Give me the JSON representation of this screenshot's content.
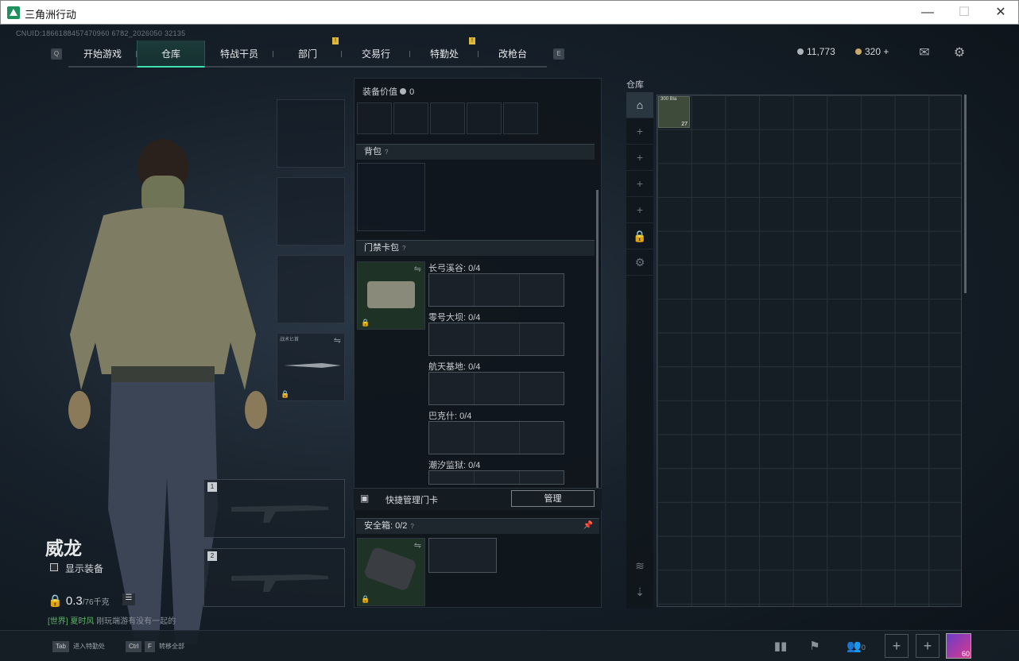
{
  "window": {
    "title": "三角洲行动",
    "min": "—",
    "max": "☐",
    "close": "✕"
  },
  "uid": "CNUID:1866188457470960 6782_2026050 32135",
  "nav": {
    "left_key": "Q",
    "right_key": "E",
    "tabs": [
      {
        "label": "开始游戏",
        "badge": ""
      },
      {
        "label": "仓库",
        "badge": "",
        "active": true
      },
      {
        "label": "特战干员",
        "badge": ""
      },
      {
        "label": "部门",
        "badge": "!"
      },
      {
        "label": "交易行",
        "badge": ""
      },
      {
        "label": "特勤处",
        "badge": "!"
      },
      {
        "label": "改枪台",
        "badge": ""
      }
    ]
  },
  "currency": {
    "silver": "11,773",
    "gold": "320",
    "gold_plus": "+"
  },
  "character": {
    "name": "威龙",
    "show_equip": "显示装备",
    "weight": "0.3",
    "weight_max": "/76千克",
    "knife_label": "战术匕首",
    "weapon1": "1",
    "weapon2": "2"
  },
  "chat": {
    "channel": "[世界]",
    "sender": "夏时风",
    "message": "刚玩端游有没有一起的"
  },
  "equipment": {
    "value_label": "装备价值",
    "value": "0",
    "backpack": "背包",
    "keycard": "门禁卡包",
    "help": "?",
    "maps": [
      {
        "label": "长弓溪谷: 0/4"
      },
      {
        "label": "零号大坝: 0/4"
      },
      {
        "label": "航天基地: 0/4"
      },
      {
        "label": "巴克什: 0/4"
      },
      {
        "label": "潮汐监狱: 0/4"
      }
    ],
    "quick_manage": "快捷管理门卡",
    "manage_btn": "管理",
    "safebox": "安全箱",
    "safebox_count": "0/2"
  },
  "stash": {
    "title": "仓库",
    "item_label": "300 Bla",
    "item_count": "27"
  },
  "bottom": {
    "tab_key": "Tab",
    "tab_hint": "进入特勤处",
    "ctrl_key": "Ctrl",
    "f_key": "F",
    "ctrl_hint": "转移全部",
    "friends": "0",
    "level": "60"
  }
}
